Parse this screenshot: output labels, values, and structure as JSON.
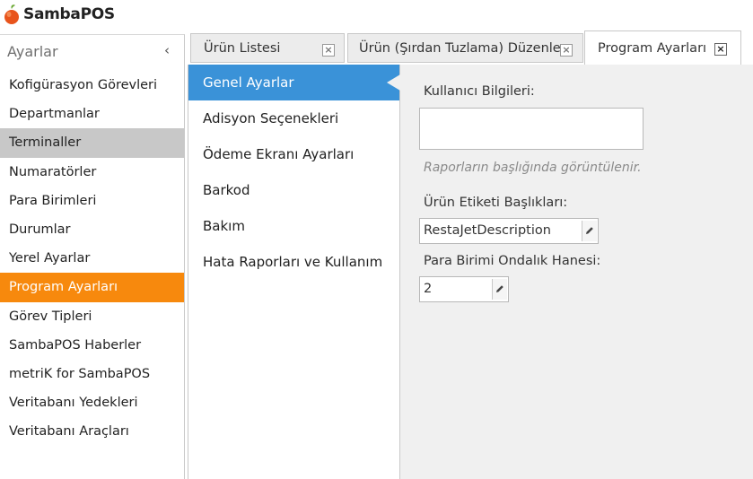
{
  "app": {
    "title": "SambaPOS"
  },
  "sidebar": {
    "title": "Ayarlar",
    "collapse_glyph": "‹",
    "items": [
      {
        "label": "Kofigürasyon Görevleri"
      },
      {
        "label": "Departmanlar"
      },
      {
        "label": "Terminaller"
      },
      {
        "label": "Numaratörler"
      },
      {
        "label": "Para Birimleri"
      },
      {
        "label": "Durumlar"
      },
      {
        "label": "Yerel Ayarlar"
      },
      {
        "label": "Program Ayarları"
      },
      {
        "label": "Görev Tipleri"
      },
      {
        "label": "SambaPOS Haberler"
      },
      {
        "label": "metriK for SambaPOS"
      },
      {
        "label": "Veritabanı Yedekleri"
      },
      {
        "label": "Veritabanı Araçları"
      }
    ],
    "selected_gray_index": 2,
    "active_index": 7,
    "active_color": "#f7890d"
  },
  "tabs": [
    {
      "label": "Ürün Listesi",
      "close": "×"
    },
    {
      "label": "Ürün (Şırdan Tuzlama) Düzenle",
      "close": "×"
    },
    {
      "label": "Program Ayarları",
      "close": "×"
    }
  ],
  "subnav": {
    "items": [
      {
        "label": "Genel Ayarlar"
      },
      {
        "label": "Adisyon Seçenekleri"
      },
      {
        "label": "Ödeme Ekranı Ayarları"
      },
      {
        "label": "Barkod"
      },
      {
        "label": "Bakım"
      },
      {
        "label": "Hata Raporları ve Kullanım"
      }
    ],
    "active_index": 0,
    "active_color": "#3a92d8"
  },
  "form": {
    "user_info_label": "Kullanıcı Bilgileri:",
    "user_info_value": "",
    "user_info_hint": "Raporların başlığında görüntülenir.",
    "product_label_titles_label": "Ürün Etiketi Başlıkları:",
    "product_label_titles_value": "RestaJetDescription",
    "currency_decimals_label": "Para Birimi Ondalık Hanesi:",
    "currency_decimals_value": "2"
  }
}
